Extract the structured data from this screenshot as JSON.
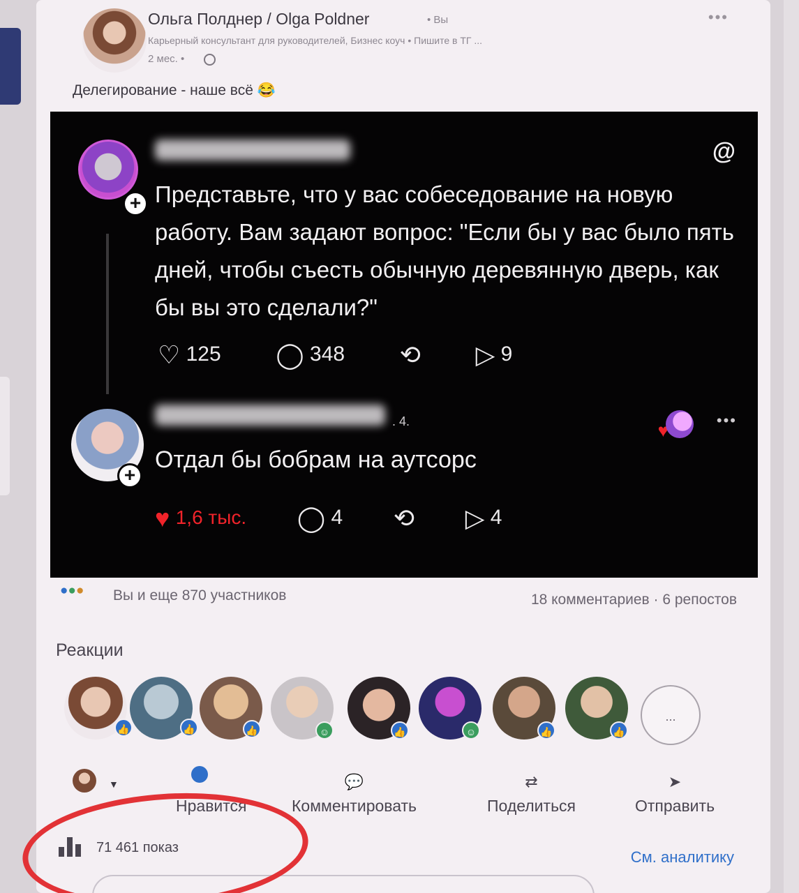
{
  "post": {
    "author_name": "Ольга Полднер / Olga Poldner",
    "author_relation": "• Вы",
    "author_headline": "Карьерный консультант для руководителей, Бизнес коуч • Пишите в ТГ ...",
    "age": "2 мес. •",
    "more": "•••",
    "text": "Делегирование - наше всё 😂"
  },
  "embed": {
    "threads_logo": "@",
    "question": "Представьте, что у вас собеседование на новую работу. Вам задают вопрос: \"Если бы у вас было пять дней, чтобы съесть обычную деревянную дверь, как бы вы это сделали?\"",
    "q_likes": "125",
    "q_comments": "348",
    "q_shares": "9",
    "reply_handle_tail": ". 4.",
    "reply_text": "Отдал бы бобрам на аутсорс",
    "reply_likes": "1,6 тыс.",
    "reply_comments": "4",
    "reply_shares": "4",
    "more": "•••",
    "plus": "+"
  },
  "social": {
    "reactions_summary": "Вы и еще 870 участников",
    "comments_reposts": "18 комментариев · 6 репостов",
    "reactions_title": "Реакции",
    "more_reactors": "..."
  },
  "actions": {
    "like_label": "Нравится",
    "comment_label": "Комментировать",
    "share_label": "Поделиться",
    "send_label": "Отправить"
  },
  "footer": {
    "impressions": "71 461 показ",
    "analytics_link": "См. аналитику"
  },
  "colors": {
    "accent": "#2f6fc9",
    "like_red": "#f0232a",
    "annotation_red": "#e23236",
    "dark_bg": "#050405"
  },
  "icons": [
    "globe-icon",
    "threads-icon",
    "heart-icon",
    "comment-icon",
    "repost-icon",
    "send-icon",
    "like-icon",
    "stats-icon"
  ]
}
